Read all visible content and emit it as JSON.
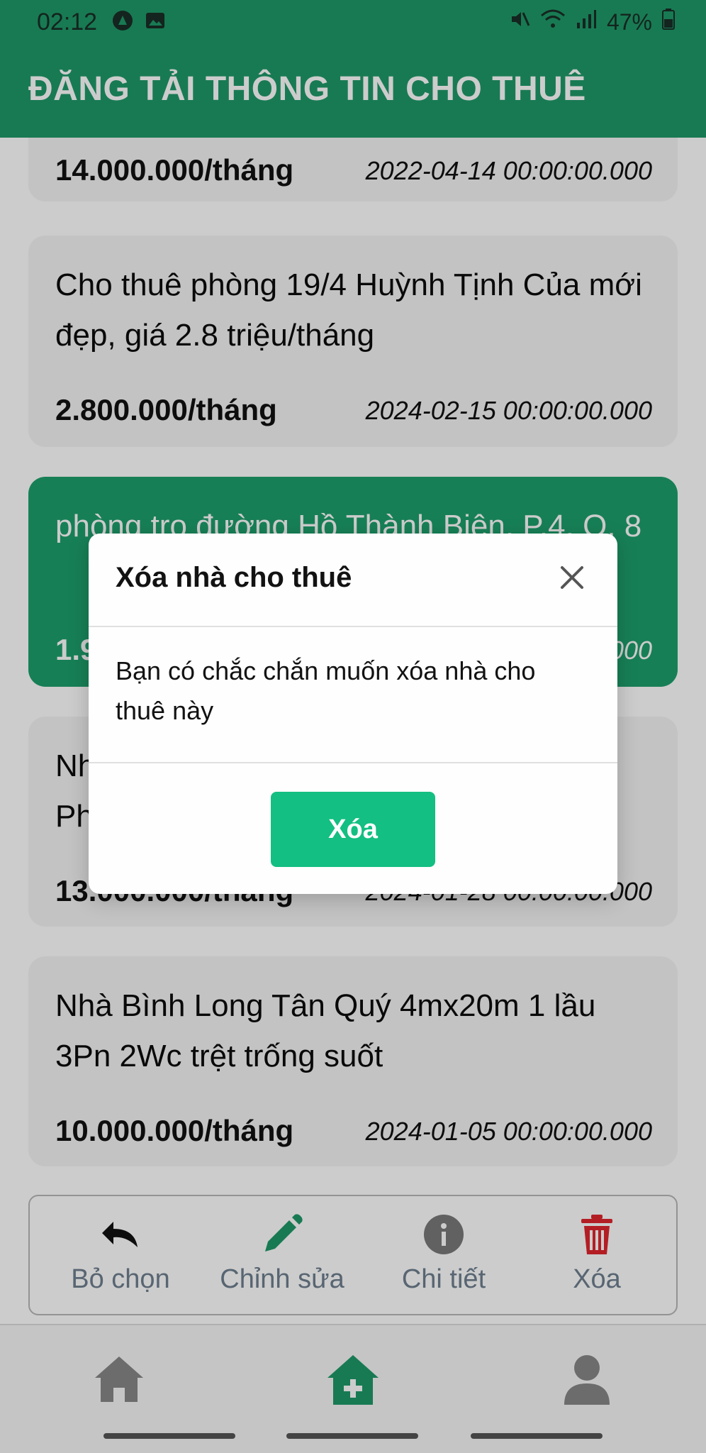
{
  "status_bar": {
    "time": "02:12",
    "battery": "47%"
  },
  "app_bar": {
    "title": "ĐĂNG TẢI THÔNG TIN CHO THUÊ"
  },
  "listings": [
    {
      "title": "",
      "price": "14.000.000/tháng",
      "date": "2022-04-14 00:00:00.000"
    },
    {
      "title": "Cho thuê phòng 19/4 Huỳnh Tịnh Của mới đẹp, giá 2.8 triệu/tháng",
      "price": "2.800.000/tháng",
      "date": "2024-02-15 00:00:00.000"
    },
    {
      "title": "phòng trọ đường Hồ Thành Biên, P.4, Q. 8",
      "price": "1.9",
      "date": "000"
    },
    {
      "title": "Nh\nPh",
      "price": "13.000.000/tháng",
      "date": "2024-01-28 00:00:00.000"
    },
    {
      "title": "Nhà Bình Long Tân Quý 4mx20m 1 lầu 3Pn 2Wc trệt trống suốt",
      "price": "10.000.000/tháng",
      "date": "2024-01-05 00:00:00.000"
    }
  ],
  "actions": {
    "deselect": "Bỏ chọn",
    "edit": "Chỉnh sửa",
    "detail": "Chi tiết",
    "delete": "Xóa"
  },
  "modal": {
    "title": "Xóa nhà cho thuê",
    "message": "Bạn có chắc chắn muốn xóa nhà cho thuê này",
    "confirm_label": "Xóa"
  },
  "colors": {
    "primary": "#1e9968",
    "selected_card": "#1d9f6c",
    "confirm_button": "#13bf82",
    "delete_icon": "#e0262e"
  }
}
